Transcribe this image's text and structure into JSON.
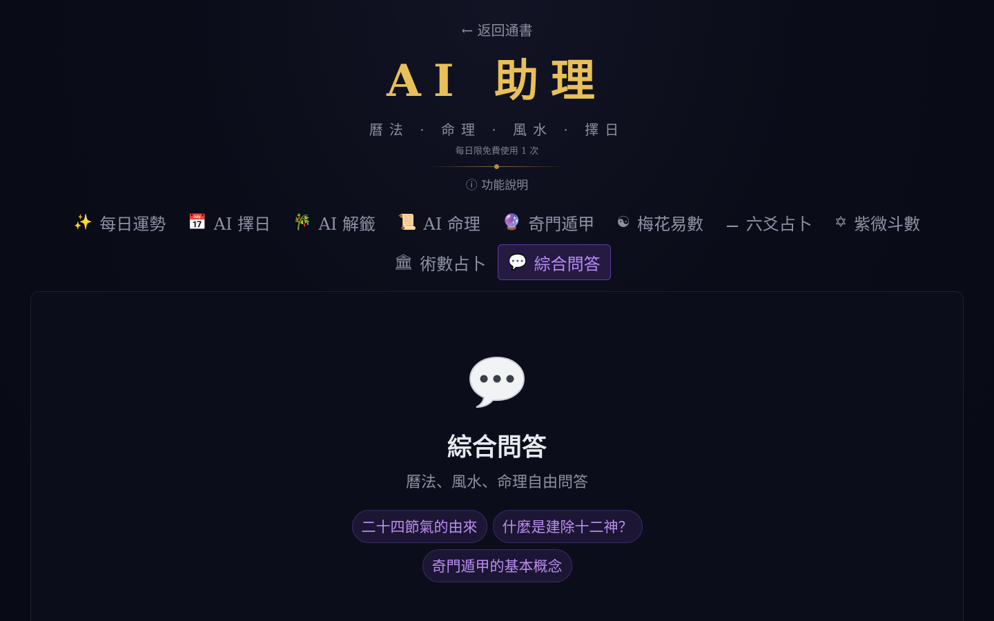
{
  "header": {
    "back_label": "← 返回通書",
    "title": "AI 助理",
    "subtitle": "曆法 · 命理 · 風水 · 擇日",
    "limit_note": "每日限免費使用 1 次",
    "feature_info": "ⓘ 功能說明"
  },
  "tabs": [
    {
      "icon": "✨",
      "label": "每日運勢",
      "active": false
    },
    {
      "icon": "📅",
      "label": "AI 擇日",
      "active": false
    },
    {
      "icon": "🎋",
      "label": "AI 解籤",
      "active": false
    },
    {
      "icon": "📜",
      "label": "AI 命理",
      "active": false
    },
    {
      "icon": "🔮",
      "label": "奇門遁甲",
      "active": false
    },
    {
      "icon": "☯",
      "label": "梅花易數",
      "active": false
    },
    {
      "icon": "⚊",
      "label": "六爻占卜",
      "active": false
    },
    {
      "icon": "✡",
      "label": "紫微斗數",
      "active": false
    },
    {
      "icon": "🏛",
      "label": "術數占卜",
      "active": false
    },
    {
      "icon": "💬",
      "label": "綜合問答",
      "active": true
    }
  ],
  "panel": {
    "icon": "chat-bubble-icon",
    "title": "綜合問答",
    "description": "曆法、風水、命理自由問答",
    "suggestions": [
      "二十四節氣的由來",
      "什麼是建除十二神？",
      "奇門遁甲的基本概念"
    ]
  },
  "colors": {
    "background": "#080a16",
    "accent_gold": "#e8c057",
    "accent_purple": "#b78cf2",
    "active_tab_bg": "#251a42"
  }
}
